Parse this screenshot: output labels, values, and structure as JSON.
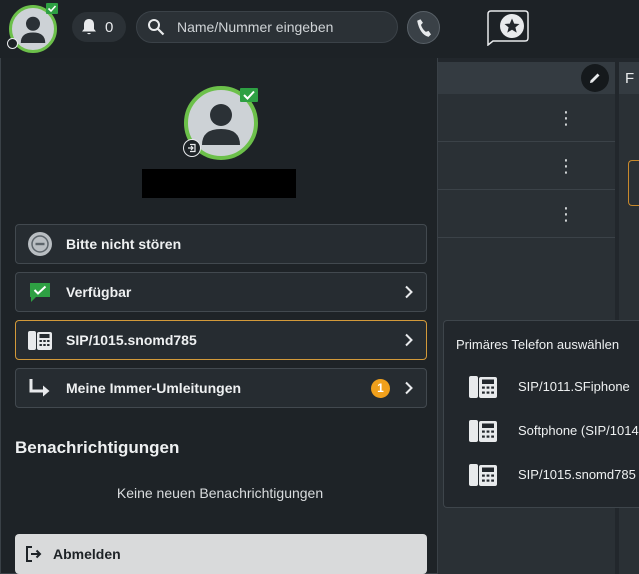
{
  "topbar": {
    "notifications_count": "0",
    "search_placeholder": "Name/Nummer eingeben"
  },
  "right_panel": {
    "second_column_heading_partial": "F"
  },
  "profile_menu": {
    "status_dnd": "Bitte nicht stören",
    "status_available": "Verfügbar",
    "primary_phone": "SIP/1015.snomd785",
    "redirects": "Meine Immer-Umleitungen",
    "redirects_count": "1",
    "notifications_heading": "Benachrichtigungen",
    "notifications_empty": "Keine neuen Benachrichtigungen",
    "logout": "Abmelden"
  },
  "phone_submenu": {
    "title": "Primäres Telefon auswählen",
    "options": [
      {
        "label": "SIP/1011.SFiphone"
      },
      {
        "label": "Softphone (SIP/1014"
      },
      {
        "label": "SIP/1015.snomd785"
      }
    ]
  },
  "colors": {
    "presence_green": "#6cc04a",
    "active_border": "#d39a3a",
    "badge_orange": "#f0a01c"
  },
  "icons": [
    "avatar-icon",
    "bell-icon",
    "search-icon",
    "phone-handset-icon",
    "star-bubble-icon",
    "pencil-icon",
    "kebab-menu-icon",
    "dnd-icon",
    "available-check-icon",
    "desk-phone-icon",
    "forward-arrow-icon",
    "logout-icon",
    "chevron-right-icon"
  ]
}
